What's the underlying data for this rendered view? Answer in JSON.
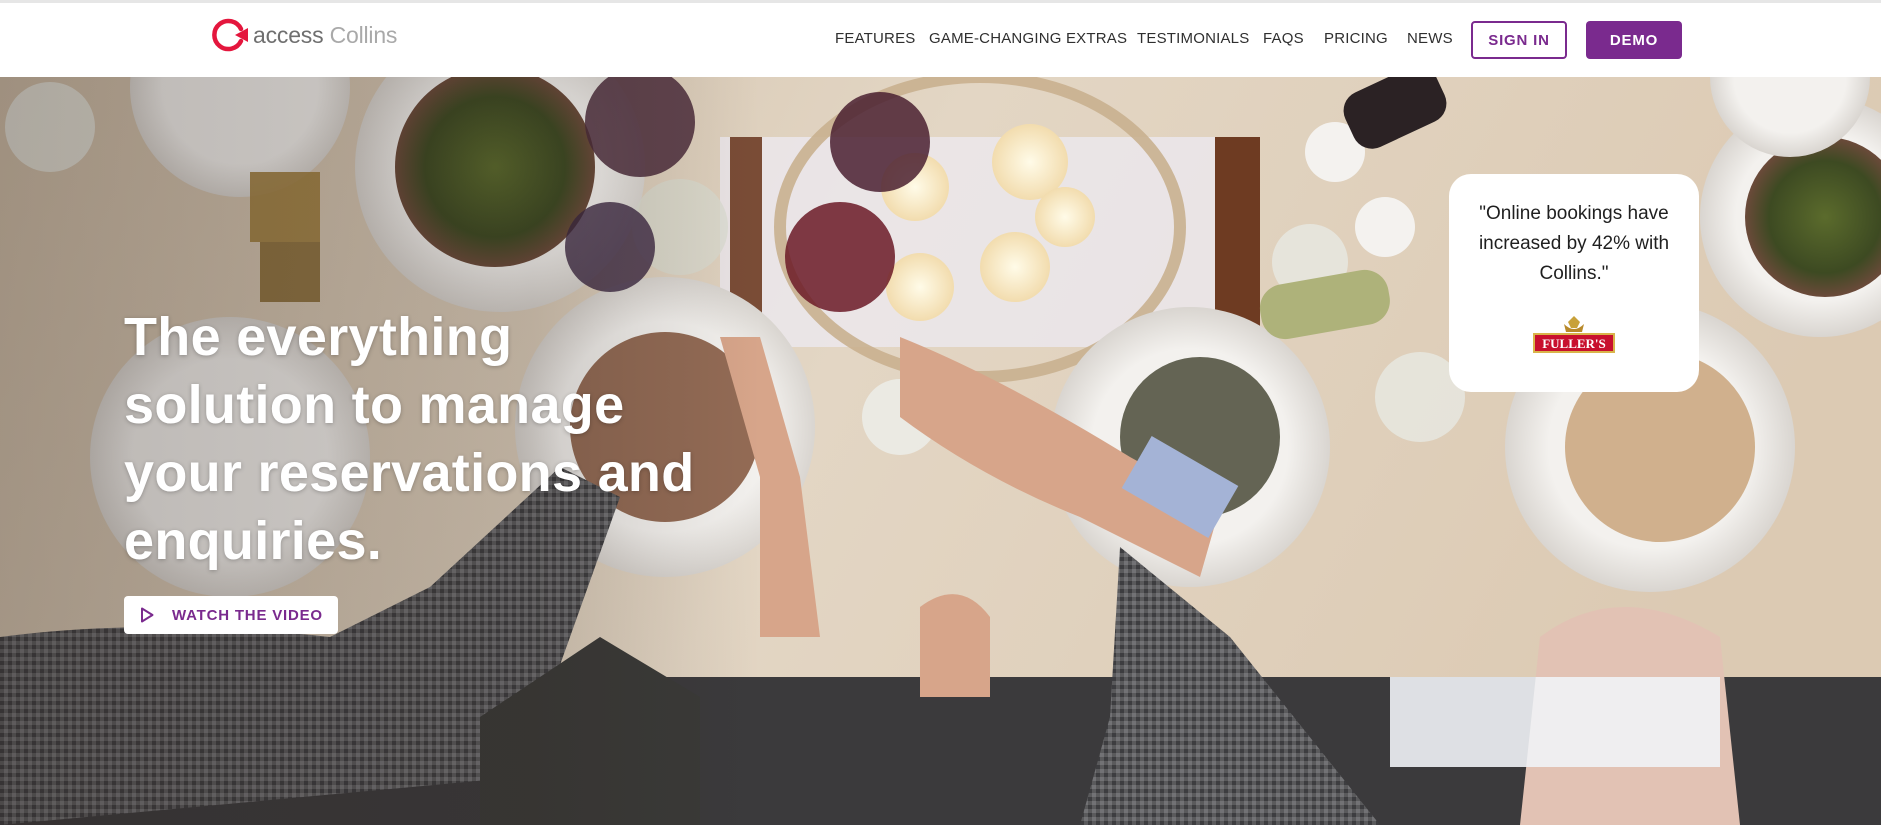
{
  "header": {
    "logo": {
      "access": "access",
      "brand": "Collins",
      "mark": "access-ring-logo-icon"
    },
    "nav": [
      {
        "label": "FEATURES"
      },
      {
        "label": "GAME-CHANGING EXTRAS"
      },
      {
        "label": "TESTIMONIALS"
      },
      {
        "label": "FAQS"
      },
      {
        "label": "PRICING"
      },
      {
        "label": "NEWS"
      }
    ],
    "signin_label": "SIGN IN",
    "demo_label": "DEMO"
  },
  "hero": {
    "headline": "The everything solution to manage your reservations and enquiries.",
    "video_button": {
      "label": "WATCH THE VIDEO",
      "icon": "play-icon"
    },
    "quote": {
      "text": "\"Online bookings have increased by 42% with Collins.\"",
      "logo_text": "FULLER'S",
      "logo_icon": "fullers-griffin-logo"
    }
  },
  "colors": {
    "brand_purple": "#7a2a8e",
    "logo_red": "#e4163d",
    "table_wood": "#d8c7b0",
    "text_dark": "#2f2f2f"
  }
}
